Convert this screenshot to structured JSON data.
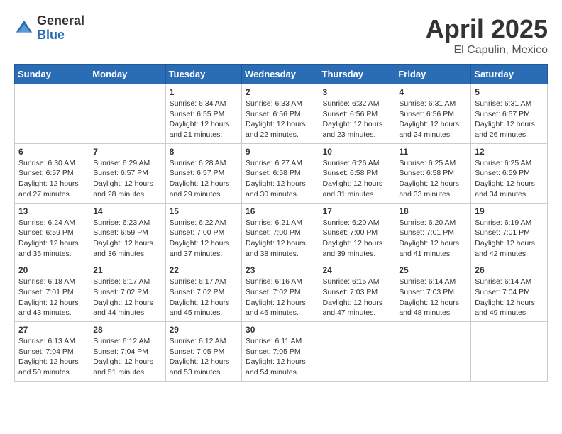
{
  "header": {
    "logo_general": "General",
    "logo_blue": "Blue",
    "month": "April 2025",
    "location": "El Capulin, Mexico"
  },
  "days_of_week": [
    "Sunday",
    "Monday",
    "Tuesday",
    "Wednesday",
    "Thursday",
    "Friday",
    "Saturday"
  ],
  "weeks": [
    [
      {
        "day": "",
        "info": ""
      },
      {
        "day": "",
        "info": ""
      },
      {
        "day": "1",
        "info": "Sunrise: 6:34 AM\nSunset: 6:55 PM\nDaylight: 12 hours and 21 minutes."
      },
      {
        "day": "2",
        "info": "Sunrise: 6:33 AM\nSunset: 6:56 PM\nDaylight: 12 hours and 22 minutes."
      },
      {
        "day": "3",
        "info": "Sunrise: 6:32 AM\nSunset: 6:56 PM\nDaylight: 12 hours and 23 minutes."
      },
      {
        "day": "4",
        "info": "Sunrise: 6:31 AM\nSunset: 6:56 PM\nDaylight: 12 hours and 24 minutes."
      },
      {
        "day": "5",
        "info": "Sunrise: 6:31 AM\nSunset: 6:57 PM\nDaylight: 12 hours and 26 minutes."
      }
    ],
    [
      {
        "day": "6",
        "info": "Sunrise: 6:30 AM\nSunset: 6:57 PM\nDaylight: 12 hours and 27 minutes."
      },
      {
        "day": "7",
        "info": "Sunrise: 6:29 AM\nSunset: 6:57 PM\nDaylight: 12 hours and 28 minutes."
      },
      {
        "day": "8",
        "info": "Sunrise: 6:28 AM\nSunset: 6:57 PM\nDaylight: 12 hours and 29 minutes."
      },
      {
        "day": "9",
        "info": "Sunrise: 6:27 AM\nSunset: 6:58 PM\nDaylight: 12 hours and 30 minutes."
      },
      {
        "day": "10",
        "info": "Sunrise: 6:26 AM\nSunset: 6:58 PM\nDaylight: 12 hours and 31 minutes."
      },
      {
        "day": "11",
        "info": "Sunrise: 6:25 AM\nSunset: 6:58 PM\nDaylight: 12 hours and 33 minutes."
      },
      {
        "day": "12",
        "info": "Sunrise: 6:25 AM\nSunset: 6:59 PM\nDaylight: 12 hours and 34 minutes."
      }
    ],
    [
      {
        "day": "13",
        "info": "Sunrise: 6:24 AM\nSunset: 6:59 PM\nDaylight: 12 hours and 35 minutes."
      },
      {
        "day": "14",
        "info": "Sunrise: 6:23 AM\nSunset: 6:59 PM\nDaylight: 12 hours and 36 minutes."
      },
      {
        "day": "15",
        "info": "Sunrise: 6:22 AM\nSunset: 7:00 PM\nDaylight: 12 hours and 37 minutes."
      },
      {
        "day": "16",
        "info": "Sunrise: 6:21 AM\nSunset: 7:00 PM\nDaylight: 12 hours and 38 minutes."
      },
      {
        "day": "17",
        "info": "Sunrise: 6:20 AM\nSunset: 7:00 PM\nDaylight: 12 hours and 39 minutes."
      },
      {
        "day": "18",
        "info": "Sunrise: 6:20 AM\nSunset: 7:01 PM\nDaylight: 12 hours and 41 minutes."
      },
      {
        "day": "19",
        "info": "Sunrise: 6:19 AM\nSunset: 7:01 PM\nDaylight: 12 hours and 42 minutes."
      }
    ],
    [
      {
        "day": "20",
        "info": "Sunrise: 6:18 AM\nSunset: 7:01 PM\nDaylight: 12 hours and 43 minutes."
      },
      {
        "day": "21",
        "info": "Sunrise: 6:17 AM\nSunset: 7:02 PM\nDaylight: 12 hours and 44 minutes."
      },
      {
        "day": "22",
        "info": "Sunrise: 6:17 AM\nSunset: 7:02 PM\nDaylight: 12 hours and 45 minutes."
      },
      {
        "day": "23",
        "info": "Sunrise: 6:16 AM\nSunset: 7:02 PM\nDaylight: 12 hours and 46 minutes."
      },
      {
        "day": "24",
        "info": "Sunrise: 6:15 AM\nSunset: 7:03 PM\nDaylight: 12 hours and 47 minutes."
      },
      {
        "day": "25",
        "info": "Sunrise: 6:14 AM\nSunset: 7:03 PM\nDaylight: 12 hours and 48 minutes."
      },
      {
        "day": "26",
        "info": "Sunrise: 6:14 AM\nSunset: 7:04 PM\nDaylight: 12 hours and 49 minutes."
      }
    ],
    [
      {
        "day": "27",
        "info": "Sunrise: 6:13 AM\nSunset: 7:04 PM\nDaylight: 12 hours and 50 minutes."
      },
      {
        "day": "28",
        "info": "Sunrise: 6:12 AM\nSunset: 7:04 PM\nDaylight: 12 hours and 51 minutes."
      },
      {
        "day": "29",
        "info": "Sunrise: 6:12 AM\nSunset: 7:05 PM\nDaylight: 12 hours and 53 minutes."
      },
      {
        "day": "30",
        "info": "Sunrise: 6:11 AM\nSunset: 7:05 PM\nDaylight: 12 hours and 54 minutes."
      },
      {
        "day": "",
        "info": ""
      },
      {
        "day": "",
        "info": ""
      },
      {
        "day": "",
        "info": ""
      }
    ]
  ]
}
